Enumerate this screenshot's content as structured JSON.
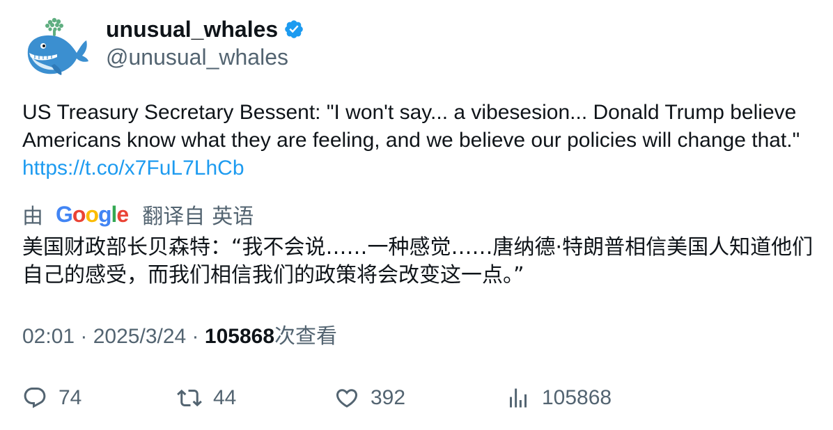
{
  "author": {
    "display_name": "unusual_whales",
    "handle": "@unusual_whales",
    "verified_icon": "verified-badge-icon",
    "avatar_icon": "whale-avatar-icon"
  },
  "tweet": {
    "text": "US Treasury Secretary Bessent: \"I won't say... a vibesesion... Donald Trump believe Americans know what they are feeling, and we believe our policies will change that.\" ",
    "link": "https://t.co/x7FuL7LhCb"
  },
  "translation": {
    "by_label": "由",
    "provider": "Google",
    "translated_from": "翻译自",
    "language": "英语",
    "text": "美国财政部长贝森特：“我不会说……一种感觉……唐纳德·特朗普相信美国人知道他们自己的感受，而我们相信我们的政策将会改变这一点。”"
  },
  "meta": {
    "time": "02:01",
    "separator": " · ",
    "date": "2025/3/24",
    "views_count": "105868",
    "views_label": "次查看"
  },
  "actions": {
    "replies": "74",
    "retweets": "44",
    "likes": "392",
    "views": "105868"
  },
  "colors": {
    "accent": "#1d9bf0",
    "secondary_text": "#536471",
    "primary_text": "#0f1419"
  }
}
